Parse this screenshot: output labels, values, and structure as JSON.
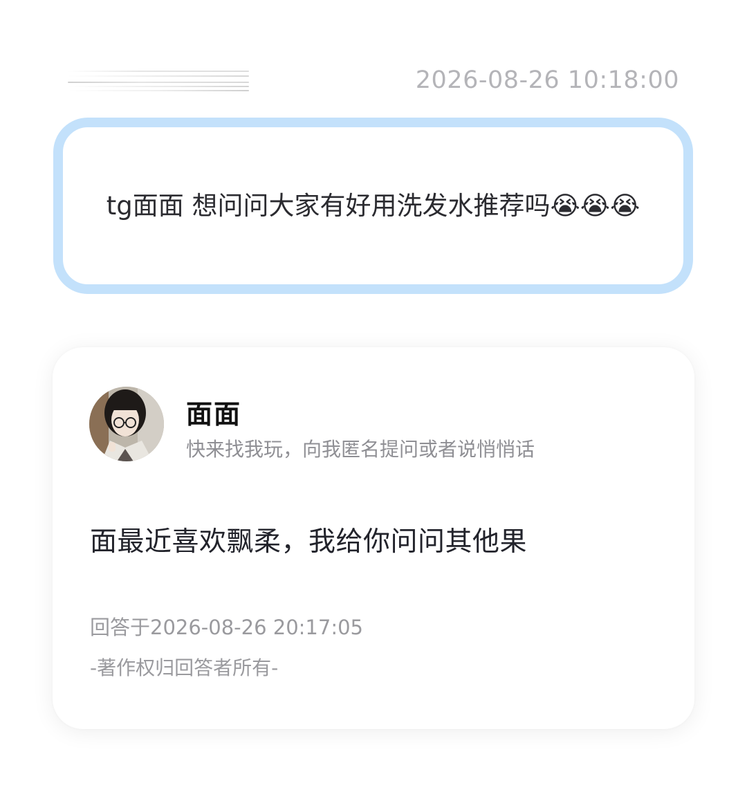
{
  "header": {
    "timestamp": "2026-08-26 10:18:00"
  },
  "question": {
    "text": "tg面面 想问问大家有好用洗发水推荐吗😭😭😭"
  },
  "answer": {
    "user_name": "面面",
    "user_bio": "快来找我玩，向我匿名提问或者说悄悄话",
    "text": "面最近喜欢飘柔，我给你问问其他果",
    "answered_at": "回答于2026-08-26 20:17:05",
    "copyright": "-著作权归回答者所有-"
  },
  "colors": {
    "question_border": "#c3e1fb",
    "timestamp": "#b4b4b8",
    "meta_text": "#9a9a9e"
  }
}
